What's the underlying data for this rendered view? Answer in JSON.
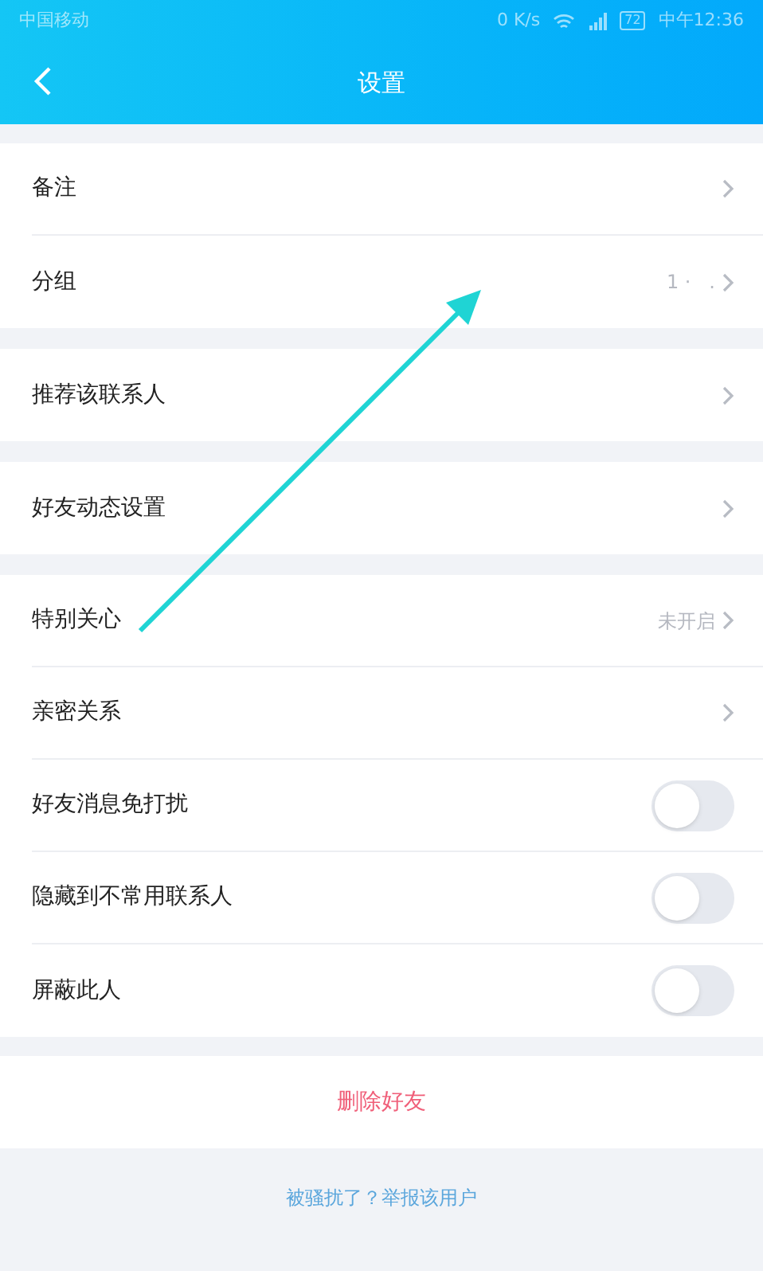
{
  "status_bar": {
    "carrier": "中国移动",
    "speed": "0 K/s",
    "battery": "72",
    "time": "中午12:36"
  },
  "header": {
    "title": "设置"
  },
  "sections": [
    {
      "rows": [
        {
          "kind": "link",
          "label": "备注"
        },
        {
          "kind": "link",
          "label": "分组",
          "value": "1 ·   ."
        }
      ]
    },
    {
      "rows": [
        {
          "kind": "link",
          "label": "推荐该联系人"
        }
      ]
    },
    {
      "rows": [
        {
          "kind": "link",
          "label": "好友动态设置"
        }
      ]
    },
    {
      "rows": [
        {
          "kind": "link",
          "label": "特别关心",
          "value": "未开启"
        },
        {
          "kind": "link",
          "label": "亲密关系"
        },
        {
          "kind": "toggle",
          "label": "好友消息免打扰",
          "on": false
        },
        {
          "kind": "toggle",
          "label": "隐藏到不常用联系人",
          "on": false
        },
        {
          "kind": "toggle",
          "label": "屏蔽此人",
          "on": false
        }
      ]
    }
  ],
  "delete_button": "删除好友",
  "report_link": "被骚扰了？举报该用户"
}
